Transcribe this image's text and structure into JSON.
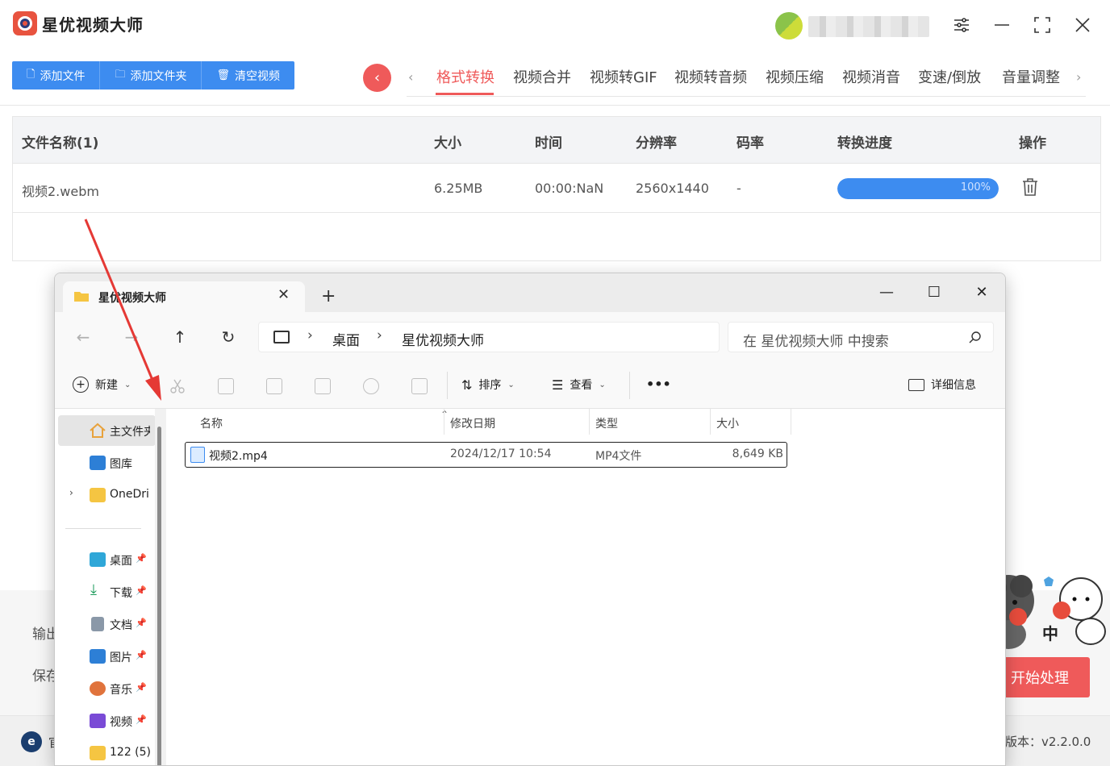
{
  "app": {
    "title": "星优视频大师",
    "toolbar": {
      "add_file": "添加文件",
      "add_folder": "添加文件夹",
      "clear_videos": "清空视频"
    },
    "tabs": [
      "格式转换",
      "视频合并",
      "视频转GIF",
      "视频转音频",
      "视频压缩",
      "视频消音",
      "变速/倒放",
      "音量调整"
    ],
    "active_tab": "格式转换",
    "table": {
      "headers": {
        "name": "文件名称(1)",
        "size": "大小",
        "time": "时间",
        "resolution": "分辨率",
        "bitrate": "码率",
        "progress": "转换进度",
        "action": "操作"
      },
      "rows": [
        {
          "name": "视频2.webm",
          "size": "6.25MB",
          "time": "00:00:NaN",
          "resolution": "2560x1440",
          "bitrate": "-",
          "progress_label": "100%",
          "progress_value": 100
        }
      ]
    },
    "bottom": {
      "output_label": "输出",
      "save_label": "保存",
      "start_button": "开始处理",
      "website_icon": "官",
      "version": "版本：v2.2.0.0"
    },
    "colors": {
      "accent_red": "#ef5a5a",
      "accent_blue": "#3d8cf0"
    }
  },
  "explorer": {
    "tab_title": "星优视频大师",
    "breadcrumb": [
      "桌面",
      "星优视频大师"
    ],
    "search_placeholder": "在 星优视频大师 中搜索",
    "commands": {
      "new": "新建",
      "sort": "排序",
      "view": "查看",
      "more": "•••",
      "details": "详细信息"
    },
    "sidebar": {
      "home": "主文件夹",
      "gallery": "图库",
      "onedrive": "OneDri",
      "pinned": [
        "桌面",
        "下载",
        "文档",
        "图片",
        "音乐",
        "视频"
      ],
      "folder": "122 (5)"
    },
    "columns": {
      "name": "名称",
      "modified": "修改日期",
      "type": "类型",
      "size": "大小"
    },
    "files": [
      {
        "name": "视频2.mp4",
        "modified": "2024/12/17 10:54",
        "type": "MP4文件",
        "size": "8,649 KB"
      }
    ]
  }
}
